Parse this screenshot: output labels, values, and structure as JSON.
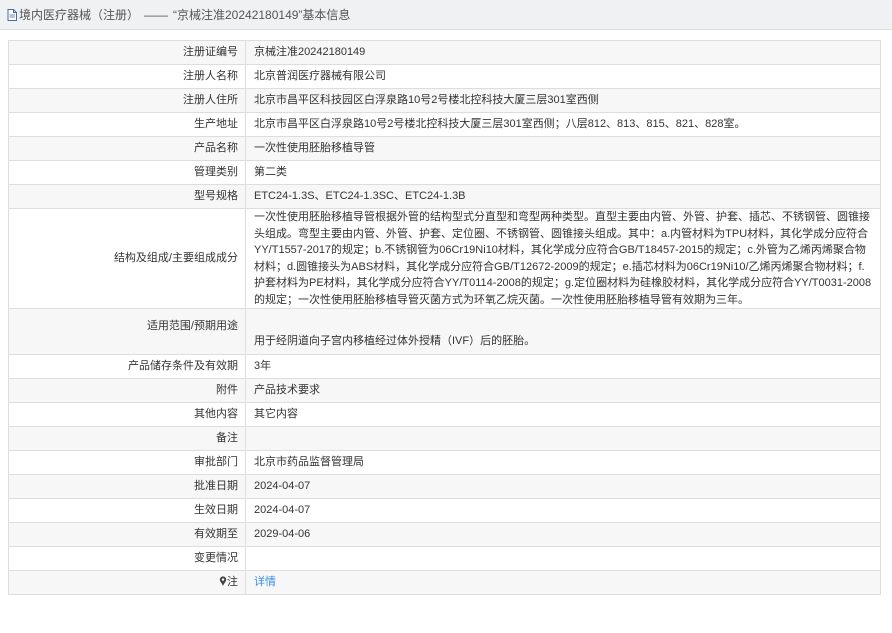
{
  "header": {
    "category": "境内医疗器械（注册）",
    "separator": "——",
    "record_title": "“京械注准20242180149”基本信息"
  },
  "rows": [
    {
      "label": "注册证编号",
      "value": "京械注准20242180149"
    },
    {
      "label": "注册人名称",
      "value": "北京普润医疗器械有限公司"
    },
    {
      "label": "注册人住所",
      "value": "北京市昌平区科技园区白浮泉路10号2号楼北控科技大厦三层301室西侧"
    },
    {
      "label": "生产地址",
      "value": "北京市昌平区白浮泉路10号2号楼北控科技大厦三层301室西侧；八层812、813、815、821、828室。"
    },
    {
      "label": "产品名称",
      "value": "一次性使用胚胎移植导管"
    },
    {
      "label": "管理类别",
      "value": "第二类"
    },
    {
      "label": "型号规格",
      "value": "ETC24-1.3S、ETC24-1.3SC、ETC24-1.3B"
    },
    {
      "label": "结构及组成/主要组成成分",
      "value": "一次性使用胚胎移植导管根据外管的结构型式分直型和弯型两种类型。直型主要由内管、外管、护套、插芯、不锈钢管、圆锥接头组成。弯型主要由内管、外管、护套、定位圈、不锈钢管、圆锥接头组成。其中：a.内管材料为TPU材料，其化学成分应符合YY/T1557-2017的规定；b.不锈钢管为06Cr19Ni10材料，其化学成分应符合GB/T18457-2015的规定；c.外管为乙烯丙烯聚合物材料；d.圆锥接头为ABS材料，其化学成分应符合GB/T12672-2009的规定；e.插芯材料为06Cr19Ni10/乙烯丙烯聚合物材料；f.护套材料为PE材料，其化学成分应符合YY/T0114-2008的规定；g.定位圈材料为硅橡胶材料，其化学成分应符合YY/T0031-2008的规定；一次性使用胚胎移植导管灭菌方式为环氧乙烷灭菌。一次性使用胚胎移植导管有效期为三年。"
    },
    {
      "label": "适用范围/预期用途",
      "value": "用于经阴道向子宫内移植经过体外授精（IVF）后的胚胎。"
    },
    {
      "label": "产品储存条件及有效期",
      "value": "3年"
    },
    {
      "label": "附件",
      "value": "产品技术要求"
    },
    {
      "label": "其他内容",
      "value": "其它内容"
    },
    {
      "label": "备注",
      "value": ""
    },
    {
      "label": "审批部门",
      "value": "北京市药品监督管理局"
    },
    {
      "label": "批准日期",
      "value": "2024-04-07"
    },
    {
      "label": "生效日期",
      "value": "2024-04-07"
    },
    {
      "label": "有效期至",
      "value": "2029-04-06"
    },
    {
      "label": "变更情况",
      "value": ""
    }
  ],
  "note_row": {
    "label": "注",
    "link": "详情"
  },
  "icons": {
    "title": "document-icon",
    "note": "pin-icon"
  },
  "colors": {
    "link": "#3a8ee6",
    "header_bg": "#f0f1f3",
    "row_alt": "#f7f7f7",
    "border": "#dddddd"
  }
}
